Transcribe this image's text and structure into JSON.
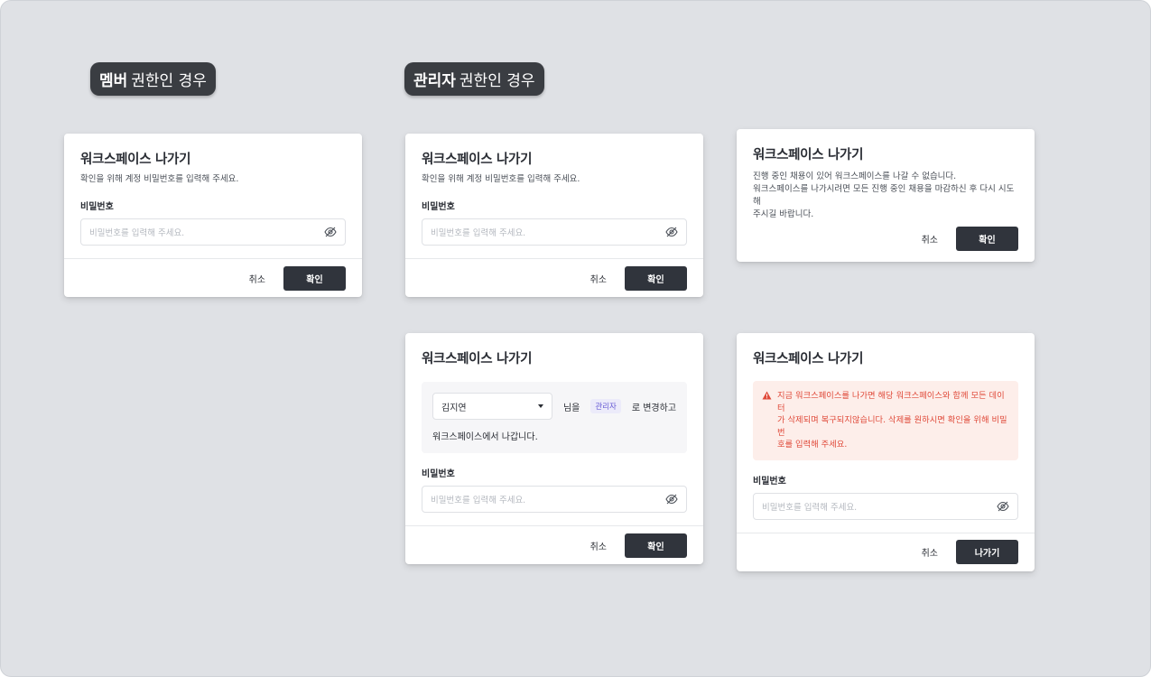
{
  "tags": {
    "member": {
      "bold": "멤버",
      "normal": "권한인 경우"
    },
    "admin": {
      "bold": "관리자",
      "normal": "권한인 경우"
    }
  },
  "common": {
    "title": "워크스페이스 나가기",
    "password_label": "비밀번호",
    "password_placeholder": "비밀번호를 입력해 주세요.",
    "cancel_label": "취소",
    "confirm_label": "확인",
    "leave_label": "나가기"
  },
  "modals": {
    "member_password": {
      "desc": "확인을 위해 계정 비밀번호를 입력해 주세요."
    },
    "admin_password": {
      "desc": "확인을 위해 계정 비밀번호를 입력해 주세요."
    },
    "admin_blocked": {
      "desc_lines": [
        "진행 중인 채용이 있어 워크스페이스를 나갈 수 없습니다.",
        "워크스페이스를 나가시려면 모든 진행 중인 채용을 마감하신 후 다시 시도해",
        "주시길 바랍니다."
      ]
    },
    "admin_transfer": {
      "selected_member": "김지연",
      "suffix_nim": "님을",
      "role_badge": "관리자",
      "suffix_change": "로 변경하고",
      "line2": "워크스페이스에서 나갑니다."
    },
    "admin_delete": {
      "warning_lines": [
        "지금 워크스페이스를 나가면 해당 워크스페이스와 함께 모든 데이터",
        "가 삭제되며 복구되지않습니다. 삭제를 원하시면 확인을 위해 비밀번",
        "호를 입력해 주세요."
      ]
    }
  },
  "icons": {
    "eye": "eye-off-icon",
    "select": "caret-down-icon",
    "warning": "warning-triangle-icon"
  },
  "colors": {
    "background": "#dfe1e5",
    "primary_button": "#30343c",
    "warning_text": "#e04a3a",
    "warning_bg": "#fdeeea",
    "badge_text": "#6b5fd6"
  }
}
